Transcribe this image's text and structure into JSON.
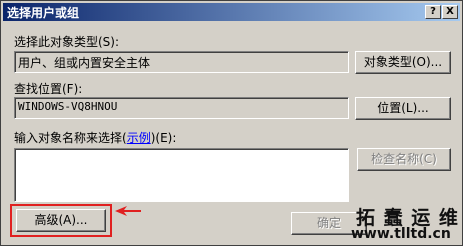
{
  "window": {
    "title": "选择用户或组",
    "help_label": "?",
    "close_label": "X"
  },
  "object_types": {
    "label": "选择此对象类型(S):",
    "value": "用户、组或内置安全主体",
    "button": "对象类型(O)..."
  },
  "location": {
    "label": "查找位置(F):",
    "value": "WINDOWS-VQ8HNOU",
    "button": "位置(L)..."
  },
  "object_names": {
    "label_prefix": "输入对象名称来选择(",
    "label_link": "示例",
    "label_suffix": ")(E):",
    "value": "",
    "check_button": "检查名称(C)"
  },
  "footer": {
    "advanced_button": "高级(A)...",
    "ok_button": "确定"
  },
  "watermark": {
    "cn": "拓 蠢 运 维",
    "url": "www.tlltd.cn"
  },
  "colors": {
    "highlight": "#e02020",
    "title_start": "#0a246a",
    "title_end": "#a6caf0"
  }
}
